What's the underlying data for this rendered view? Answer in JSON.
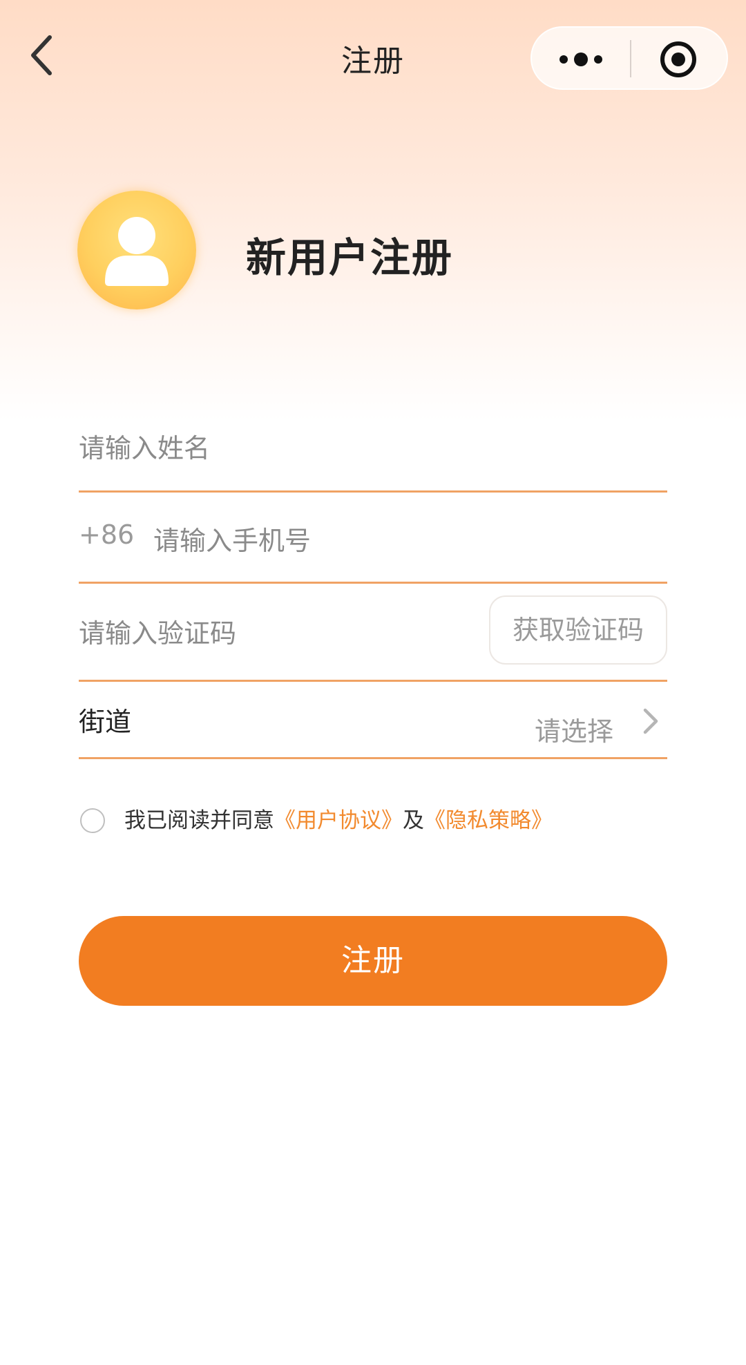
{
  "colors": {
    "accent": "#f27d21",
    "link": "#f28a2e",
    "divider": "#f0a264",
    "header_gradient_top": "#ffdcc6",
    "avatar": "#ffcf5e"
  },
  "nav": {
    "title": "注册",
    "back_icon": "chevron-left-icon",
    "more_icon": "more-dots-icon",
    "close_icon": "target-circle-icon"
  },
  "header": {
    "avatar_icon": "user-icon",
    "title": "新用户注册"
  },
  "form": {
    "name": {
      "placeholder": "请输入姓名",
      "value": ""
    },
    "phone": {
      "prefix": "+86",
      "placeholder": "请输入手机号",
      "value": ""
    },
    "code": {
      "placeholder": "请输入验证码",
      "value": "",
      "button_label": "获取验证码"
    },
    "street": {
      "label": "街道",
      "select_placeholder": "请选择",
      "chevron_icon": "chevron-right-icon"
    }
  },
  "agreement": {
    "checked": false,
    "text_before": "我已阅读并同意",
    "user_agreement_link": "《用户协议》",
    "conjunction": "及",
    "privacy_link": "《隐私策略》"
  },
  "submit": {
    "label": "注册"
  }
}
